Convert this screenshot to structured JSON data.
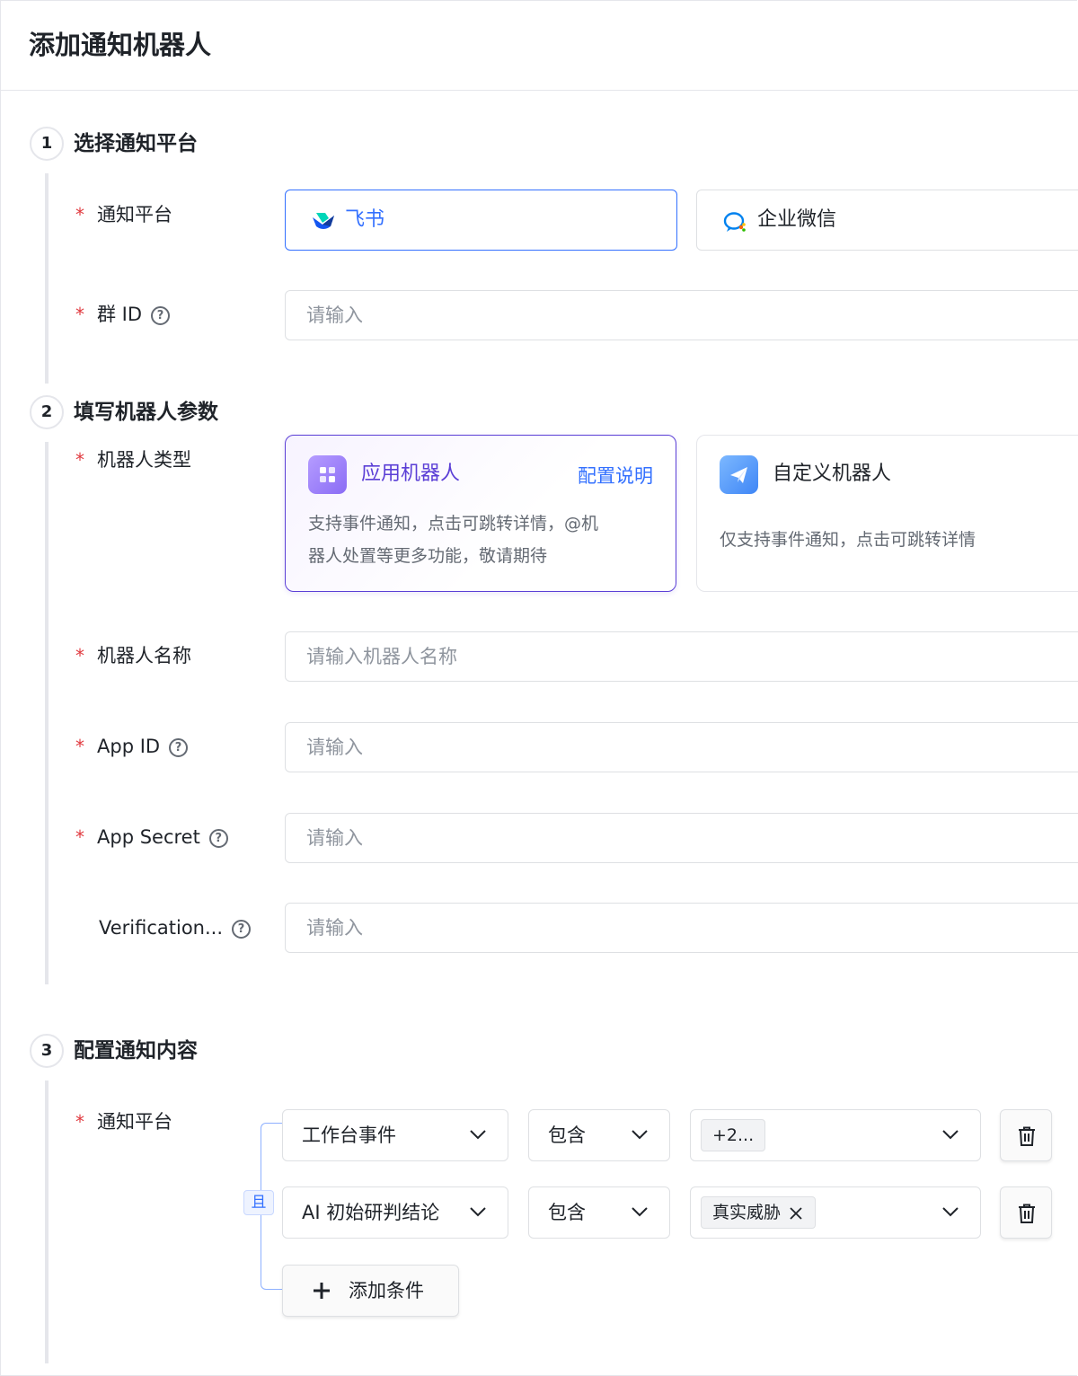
{
  "header": {
    "title": "添加通知机器人"
  },
  "steps": [
    {
      "num": "1",
      "title": "选择通知平台"
    },
    {
      "num": "2",
      "title": "填写机器人参数"
    },
    {
      "num": "3",
      "title": "配置通知内容"
    }
  ],
  "step1": {
    "platform_label": "通知平台",
    "platforms": [
      {
        "name": "飞书",
        "icon": "feishu-logo-icon",
        "selected": true
      },
      {
        "name": "企业微信",
        "icon": "wecom-logo-icon",
        "selected": false
      }
    ],
    "group_id_label": "群 ID",
    "group_id_placeholder": "请输入"
  },
  "step2": {
    "robot_type_label": "机器人类型",
    "robot_types": [
      {
        "title": "应用机器人",
        "link": "配置说明",
        "desc_line1": "支持事件通知，点击可跳转详情，@机",
        "desc_line2": "器人处置等更多功能，敬请期待",
        "selected": true,
        "icon": "app-robot-icon"
      },
      {
        "title": "自定义机器人",
        "desc_line1": "仅支持事件通知，点击可跳转详情",
        "selected": false,
        "icon": "paper-plane-icon"
      }
    ],
    "robot_name_label": "机器人名称",
    "robot_name_placeholder": "请输入机器人名称",
    "app_id_label": "App ID",
    "app_id_placeholder": "请输入",
    "app_secret_label": "App Secret",
    "app_secret_placeholder": "请输入",
    "verification_label": "Verification...",
    "verification_placeholder": "请输入"
  },
  "step3": {
    "platform_label": "通知平台",
    "logic": "且",
    "conditions": [
      {
        "field": "工作台事件",
        "op": "包含",
        "value_tag": "+2..."
      },
      {
        "field": "AI 初始研判结论",
        "op": "包含",
        "value_tag": "真实威胁"
      }
    ],
    "add_condition_label": "添加条件"
  },
  "colors": {
    "accent": "#3370ff",
    "purple": "#5b3fd6",
    "required": "#e0393e"
  }
}
